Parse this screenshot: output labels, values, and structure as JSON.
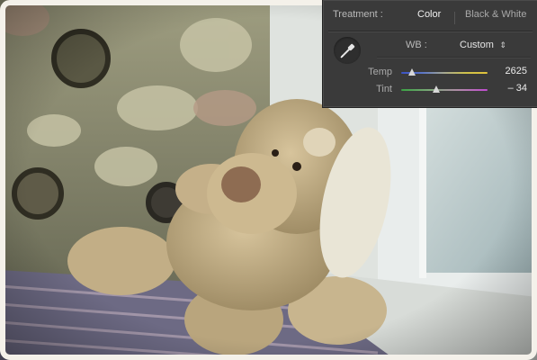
{
  "photo": {
    "subject": "teddy-dog",
    "colors": {
      "curtain": "#8c8d72",
      "plush": "#c8b48c",
      "ear": "#e9e5d6",
      "window_frame": "#e8eceb",
      "window_glass": "#b7c7c8",
      "rug": "#6d6a84"
    }
  },
  "panel": {
    "treatment_label": "Treatment :",
    "treatment_options": [
      "Color",
      "Black & White"
    ],
    "treatment_selected": "Color",
    "wb_label": "WB :",
    "wb_value": "Custom",
    "sliders": [
      {
        "label": "Temp",
        "value_text": "2625",
        "position": 0.12
      },
      {
        "label": "Tint",
        "value_text": "– 34",
        "position": 0.41
      }
    ],
    "icons": {
      "eyedropper": "eyedropper-icon",
      "wb_chevron": "updown-chevron-icon"
    }
  }
}
